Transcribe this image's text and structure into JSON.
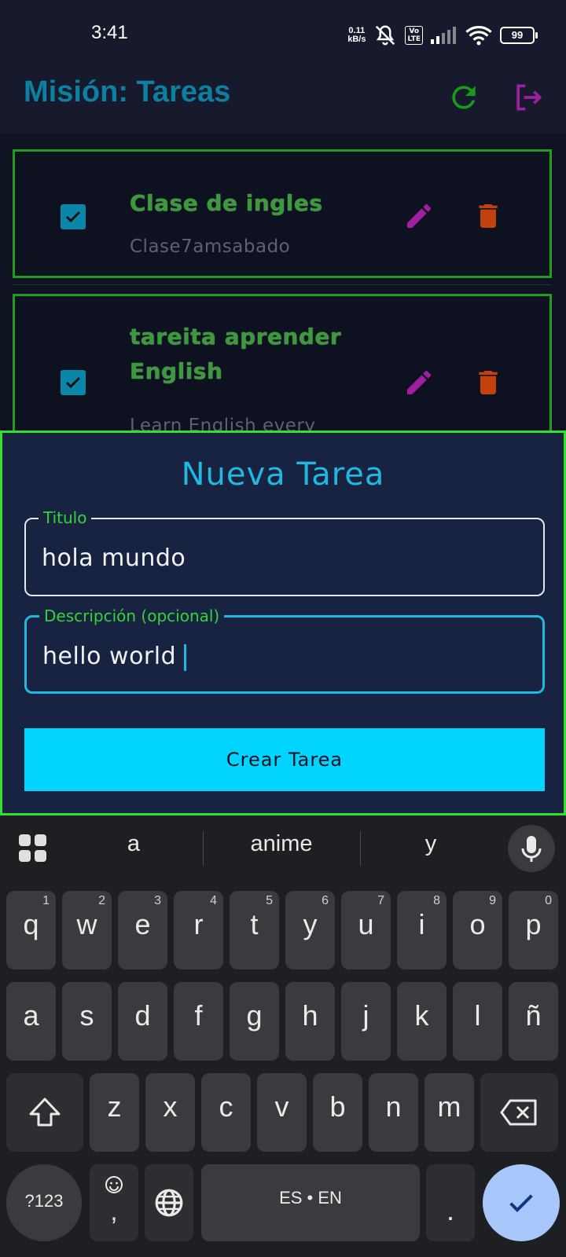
{
  "status_bar": {
    "time": "3:41",
    "net_speed_value": "0.11",
    "net_speed_unit": "kB/s",
    "volte_top": "Vo",
    "volte_bottom": "LTE",
    "battery": "99"
  },
  "app_bar": {
    "title": "Misión: Tareas",
    "icons": [
      "refresh-icon",
      "logout-icon"
    ],
    "colors": {
      "title": "#0d7fa0",
      "refresh": "#1a9a1a",
      "logout": "#a01fa0"
    }
  },
  "tasks": [
    {
      "title": "Clase de ingles",
      "description": "Clase7amsabado",
      "completed": true
    },
    {
      "title": "tareita aprender English",
      "description": "Learn English every",
      "completed": true
    }
  ],
  "new_task": {
    "heading": "Nueva Tarea",
    "title_label": "Titulo",
    "title_value": "hola mundo",
    "description_label": "Descripción (opcional)",
    "description_value": "hello world",
    "submit_label": "Crear Tarea"
  },
  "keyboard": {
    "suggestions": [
      "a",
      "anime",
      "y"
    ],
    "row1": [
      {
        "key": "q",
        "hint": "1"
      },
      {
        "key": "w",
        "hint": "2"
      },
      {
        "key": "e",
        "hint": "3"
      },
      {
        "key": "r",
        "hint": "4"
      },
      {
        "key": "t",
        "hint": "5"
      },
      {
        "key": "y",
        "hint": "6"
      },
      {
        "key": "u",
        "hint": "7"
      },
      {
        "key": "i",
        "hint": "8"
      },
      {
        "key": "o",
        "hint": "9"
      },
      {
        "key": "p",
        "hint": "0"
      }
    ],
    "row2": [
      "a",
      "s",
      "d",
      "f",
      "g",
      "h",
      "j",
      "k",
      "l",
      "ñ"
    ],
    "row3": [
      "z",
      "x",
      "c",
      "v",
      "b",
      "n",
      "m"
    ],
    "symbols_label": "?123",
    "comma_label": ",",
    "space_label": "ES • EN",
    "period_label": "."
  }
}
